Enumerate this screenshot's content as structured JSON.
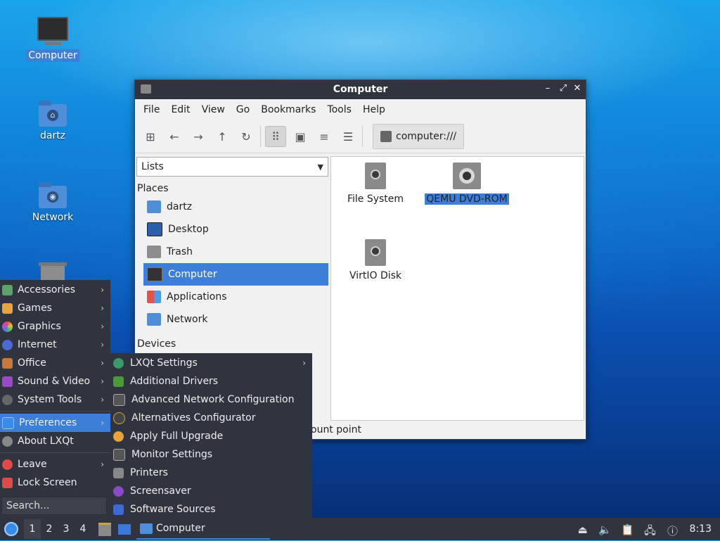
{
  "desktop": {
    "icons": [
      {
        "label": "Computer"
      },
      {
        "label": "dartz"
      },
      {
        "label": "Network"
      }
    ]
  },
  "window": {
    "title": "Computer",
    "controls": {
      "minimize": "–",
      "maximize": "⤢",
      "close": "✕"
    },
    "menu": [
      "File",
      "Edit",
      "View",
      "Go",
      "Bookmarks",
      "Tools",
      "Help"
    ],
    "location": "computer:///",
    "sidebar_mode": "Lists",
    "places_header": "Places",
    "places": [
      "dartz",
      "Desktop",
      "Trash",
      "Computer",
      "Applications",
      "Network"
    ],
    "devices_header": "Devices",
    "items": [
      "File System",
      "QEMU DVD-ROM",
      "VirtIO Disk"
    ],
    "status": "ount point"
  },
  "start_menu": {
    "categories": [
      "Accessories",
      "Games",
      "Graphics",
      "Internet",
      "Office",
      "Sound & Video",
      "System Tools"
    ],
    "preferences": "Preferences",
    "about": "About LXQt",
    "leave": "Leave",
    "lock": "Lock Screen",
    "search_placeholder": "Search..."
  },
  "preferences_submenu": [
    "LXQt Settings",
    "Additional Drivers",
    "Advanced Network Configuration",
    "Alternatives Configurator",
    "Apply Full Upgrade",
    "Monitor Settings",
    "Printers",
    "Screensaver",
    "Software Sources"
  ],
  "panel": {
    "workspaces": [
      "1",
      "2",
      "3",
      "4"
    ],
    "task": "Computer",
    "clock": "8:13"
  }
}
